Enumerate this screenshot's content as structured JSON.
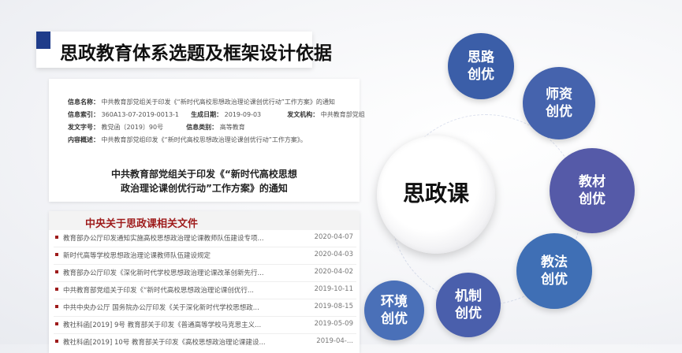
{
  "title": "思政教育体系选题及框架设计依据",
  "doc": {
    "rows": [
      {
        "k1": "信息名称：",
        "v1": "中共教育部党组关于印发《“新时代高校思想政治理论课创优行动”工作方案》的通知"
      },
      {
        "k1": "信息索引：",
        "v1": "360A13-07-2019-0013-1",
        "k2": "生成日期：",
        "v2": "2019-09-03",
        "k3": "发文机构：",
        "v3": "中共教育部党组"
      },
      {
        "k1": "发文字号：",
        "v1": "教党函〔2019〕90号",
        "k2": "信息类别：",
        "v2": "高等教育"
      },
      {
        "k1": "内容概述：",
        "v1": "中共教育部党组印发《“新时代高校思想政治理论课创优行动”工作方案》。"
      }
    ],
    "heading_line1": "中共教育部党组关于印发《“新时代高校思想",
    "heading_line2": "政治理论课创优行动”工作方案》的通知"
  },
  "list": {
    "header": "中央关于思政课相关文件",
    "items": [
      {
        "text": "教育部办公厅印发通知实施高校思想政治理论课教师队伍建设专项...",
        "date": "2020-04-07"
      },
      {
        "text": "新时代高等学校思想政治理论课教师队伍建设规定",
        "date": "2020-04-03"
      },
      {
        "text": "教育部办公厅印发《深化新时代学校思想政治理论课改革创新先行...",
        "date": "2020-04-02"
      },
      {
        "text": "中共教育部党组关于印发《“新时代高校思想政治理论课创优行...",
        "date": "2019-10-11"
      },
      {
        "text": "中共中央办公厅 国务院办公厅印发《关于深化新时代学校思想政...",
        "date": "2019-08-15"
      },
      {
        "text": "教社科函[2019] 9号 教育部关于印发《普通高等学校马克思主义...",
        "date": "2019-05-09"
      },
      {
        "text": "教社科函[2019] 10号 教育部关于印发《高校思想政治理论课建设...",
        "date": "2019-04-..."
      }
    ]
  },
  "diagram": {
    "center": "思政课",
    "nodes": [
      {
        "line1": "思路",
        "line2": "创优",
        "color": "#3b5ea8"
      },
      {
        "line1": "师资",
        "line2": "创优",
        "color": "#4563ad"
      },
      {
        "line1": "教材",
        "line2": "创优",
        "color": "#555aa8"
      },
      {
        "line1": "教法",
        "line2": "创优",
        "color": "#3f6fb5"
      },
      {
        "line1": "机制",
        "line2": "创优",
        "color": "#4a5fac"
      },
      {
        "line1": "环境",
        "line2": "创优",
        "color": "#4a70b8"
      }
    ]
  }
}
